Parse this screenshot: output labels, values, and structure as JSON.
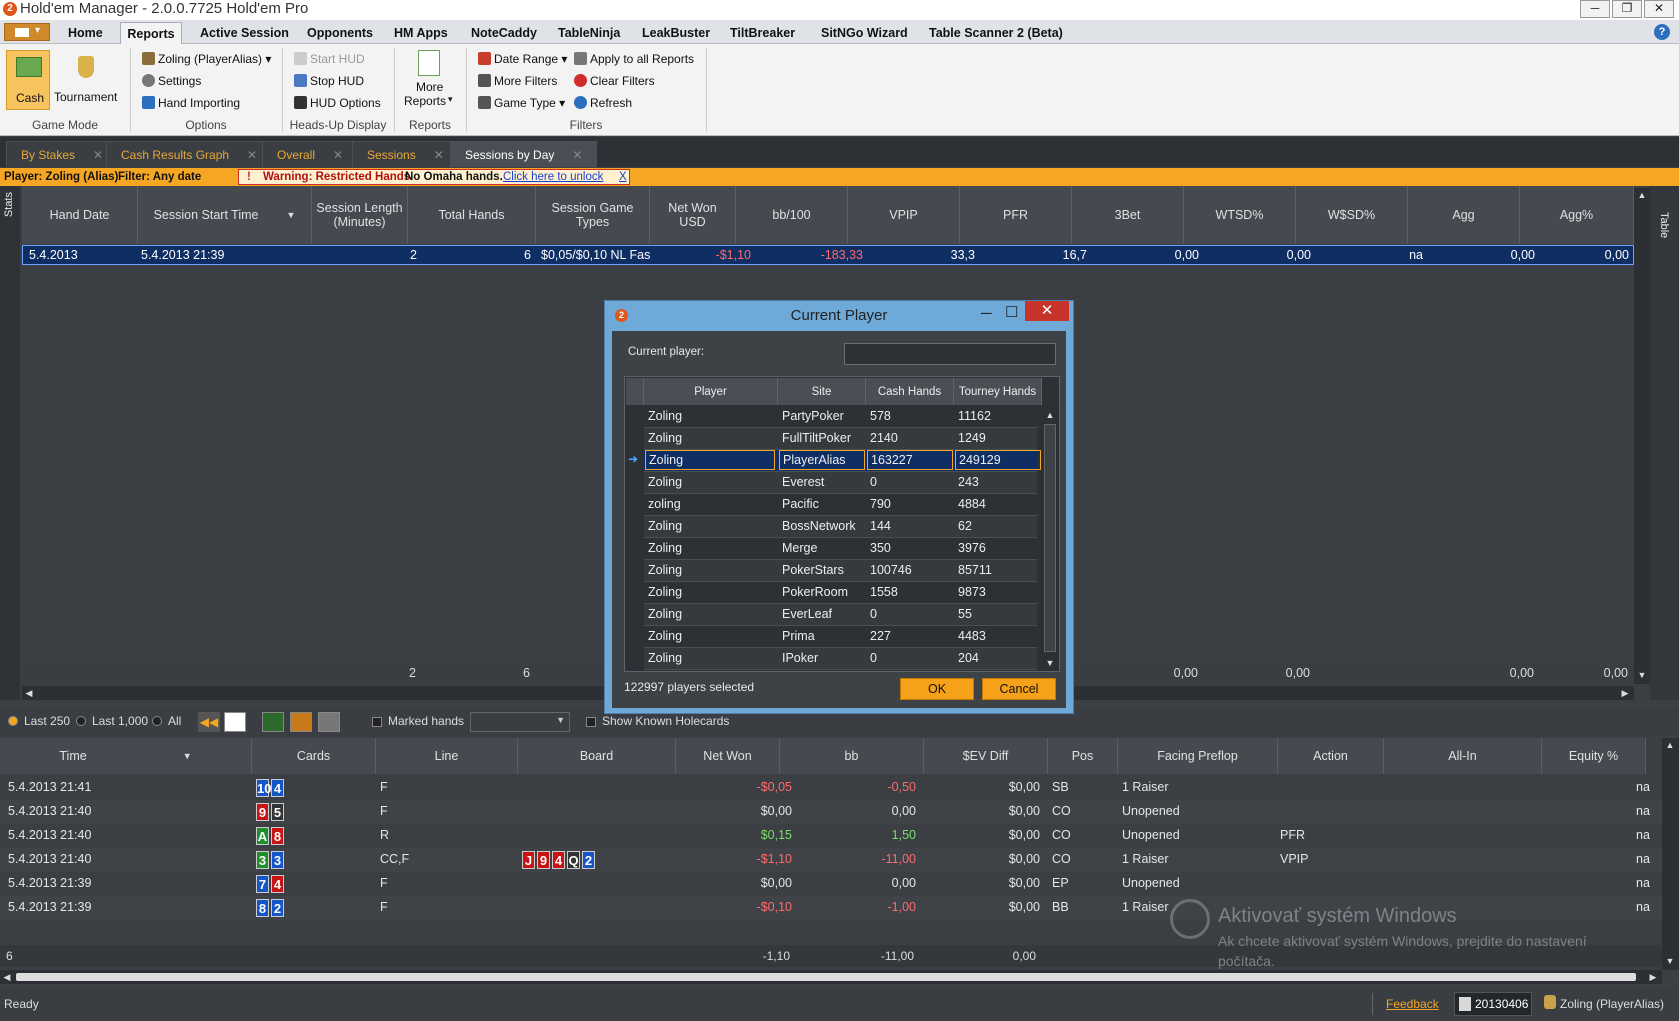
{
  "window": {
    "title": "Hold'em Manager - 2.0.0.7725 Hold'em Pro",
    "app_icon": "hm2-logo-icon",
    "controls": [
      "─",
      "❐",
      "✕"
    ]
  },
  "menu": {
    "app_button": "app-menu-icon",
    "tabs": [
      "Home",
      "Reports",
      "Active Session",
      "Opponents",
      "HM Apps",
      "NoteCaddy",
      "TableNinja",
      "LeakBuster",
      "TiltBreaker",
      "SitNGo Wizard",
      "Table Scanner 2 (Beta)"
    ],
    "active": "Reports",
    "help": "?"
  },
  "ribbon": {
    "game_mode": {
      "cash": "Cash",
      "tournament": "Tournament",
      "label": "Game Mode"
    },
    "options": {
      "player": "Zoling (PlayerAlias)",
      "settings": "Settings",
      "hand_importing": "Hand Importing",
      "label": "Options"
    },
    "hud": {
      "start": "Start HUD",
      "stop": "Stop HUD",
      "options": "HUD Options",
      "label": "Heads-Up Display"
    },
    "reports": {
      "more": "More",
      "reports": "Reports",
      "label": "Reports"
    },
    "filters": {
      "date_range": "Date Range",
      "more_filters": "More Filters",
      "game_type": "Game Type",
      "apply_all": "Apply to all Reports",
      "clear": "Clear Filters",
      "refresh": "Refresh",
      "label": "Filters"
    }
  },
  "doc_tabs": [
    {
      "label": "By Stakes"
    },
    {
      "label": "Cash Results Graph"
    },
    {
      "label": "Overall"
    },
    {
      "label": "Sessions"
    },
    {
      "label": "Sessions by Day"
    }
  ],
  "info": {
    "player": "Player: Zoling (Alias)",
    "filter": "Filter: Any date",
    "warning": "Warning: Restricted Hands",
    "no_omaha": "No Omaha hands.",
    "unlock": "Click here to unlock",
    "close": "X"
  },
  "side_tabs": {
    "stats": "Stats",
    "table": "Table"
  },
  "grid": {
    "headers": [
      "Hand Date",
      "Session Start Time",
      "Session Length (Minutes)",
      "Total Hands",
      "Session Game Types",
      "Net Won USD",
      "bb/100",
      "VPIP",
      "PFR",
      "3Bet",
      "WTSD%",
      "W$SD%",
      "Agg",
      "Agg%"
    ],
    "row": {
      "date": "5.4.2013",
      "start": "5.4.2013 21:39",
      "length": "2",
      "hands": "6",
      "types": "$0,05/$0,10 NL Fas",
      "net": "-$1,10",
      "bb100": "-183,33",
      "vpip": "33,3",
      "pfr": "16,7",
      "threebet": "0,00",
      "wtsd": "0,00",
      "wsd": "na",
      "agg": "0,00",
      "aggp": "0,00"
    },
    "footer": {
      "length": "2",
      "hands": "6",
      "threebet": "0,00",
      "wtsd": "0,00",
      "agg": "0,00",
      "aggp": "0,00"
    }
  },
  "hand_toolbar": {
    "last250": "Last 250",
    "last1000": "Last 1,000",
    "all": "All",
    "marked": "Marked hands",
    "known": "Show Known Holecards"
  },
  "hands": {
    "headers": [
      "Time",
      "Cards",
      "Line",
      "Board",
      "Net Won",
      "bb",
      "$EV Diff",
      "Pos",
      "Facing Preflop",
      "Action",
      "All-In",
      "Equity %"
    ],
    "rows": [
      {
        "time": "5.4.2013 21:41",
        "cards": [
          {
            "v": "10",
            "c": "b"
          },
          {
            "v": "4",
            "c": "b"
          }
        ],
        "line": "F",
        "board": [],
        "net": "-$0,05",
        "bb": "-0,50",
        "ev": "$0,00",
        "pos": "SB",
        "facing": "1 Raiser",
        "action": "",
        "eq": "na",
        "sign": "neg"
      },
      {
        "time": "5.4.2013 21:40",
        "cards": [
          {
            "v": "9",
            "c": "r"
          },
          {
            "v": "5",
            "c": "k"
          }
        ],
        "line": "F",
        "board": [],
        "net": "$0,00",
        "bb": "0,00",
        "ev": "$0,00",
        "pos": "CO",
        "facing": "Unopened",
        "action": "",
        "eq": "na",
        "sign": ""
      },
      {
        "time": "5.4.2013 21:40",
        "cards": [
          {
            "v": "A",
            "c": "g"
          },
          {
            "v": "8",
            "c": "r"
          }
        ],
        "line": "R",
        "board": [],
        "net": "$0,15",
        "bb": "1,50",
        "ev": "$0,00",
        "pos": "CO",
        "facing": "Unopened",
        "action": "PFR",
        "eq": "na",
        "sign": "pos"
      },
      {
        "time": "5.4.2013 21:40",
        "cards": [
          {
            "v": "3",
            "c": "g"
          },
          {
            "v": "3",
            "c": "b"
          }
        ],
        "line": "CC,F",
        "board": [
          {
            "v": "J",
            "c": "r"
          },
          {
            "v": "9",
            "c": "r"
          },
          {
            "v": "4",
            "c": "r"
          },
          {
            "v": "Q",
            "c": "k"
          },
          {
            "v": "2",
            "c": "b"
          }
        ],
        "net": "-$1,10",
        "bb": "-11,00",
        "ev": "$0,00",
        "pos": "CO",
        "facing": "1 Raiser",
        "action": "VPIP",
        "eq": "na",
        "sign": "neg"
      },
      {
        "time": "5.4.2013 21:39",
        "cards": [
          {
            "v": "7",
            "c": "b"
          },
          {
            "v": "4",
            "c": "r"
          }
        ],
        "line": "F",
        "board": [],
        "net": "$0,00",
        "bb": "0,00",
        "ev": "$0,00",
        "pos": "EP",
        "facing": "Unopened",
        "action": "",
        "eq": "na",
        "sign": ""
      },
      {
        "time": "5.4.2013 21:39",
        "cards": [
          {
            "v": "8",
            "c": "b"
          },
          {
            "v": "2",
            "c": "b"
          }
        ],
        "line": "F",
        "board": [],
        "net": "-$0,10",
        "bb": "-1,00",
        "ev": "$0,00",
        "pos": "BB",
        "facing": "1 Raiser",
        "action": "",
        "eq": "na",
        "sign": "neg"
      }
    ],
    "footer": {
      "count": "6",
      "net": "-1,10",
      "bb": "-11,00",
      "ev": "0,00"
    }
  },
  "status": {
    "ready": "Ready",
    "feedback": "Feedback",
    "db": "20130406",
    "player": "Zoling (PlayerAlias)"
  },
  "watermark": {
    "title": "Aktivovať systém Windows",
    "line1": "Ak chcete aktivovať systém Windows, prejdite do nastavení",
    "line2": "počítača."
  },
  "dialog": {
    "title": "Current Player",
    "icon": "hm2-logo-icon",
    "controls": [
      "─",
      "☐",
      "✕"
    ],
    "label": "Current player:",
    "input_value": "",
    "headers": [
      "Player",
      "Site",
      "Cash Hands",
      "Tourney Hands"
    ],
    "rows": [
      [
        "Zoling",
        "PartyPoker",
        "578",
        "11162"
      ],
      [
        "Zoling",
        "FullTiltPoker",
        "2140",
        "1249"
      ],
      [
        "Zoling",
        "PlayerAlias",
        "163227",
        "249129"
      ],
      [
        "Zoling",
        "Everest",
        "0",
        "243"
      ],
      [
        "zoling",
        "Pacific",
        "790",
        "4884"
      ],
      [
        "Zoling",
        "BossNetwork",
        "144",
        "62"
      ],
      [
        "Zoling",
        "Merge",
        "350",
        "3976"
      ],
      [
        "Zoling",
        "PokerStars",
        "100746",
        "85711"
      ],
      [
        "Zoling",
        "PokerRoom",
        "1558",
        "9873"
      ],
      [
        "Zoling",
        "EverLeaf",
        "0",
        "55"
      ],
      [
        "Zoling",
        "Prima",
        "227",
        "4483"
      ],
      [
        "Zoling",
        "IPoker",
        "0",
        "204"
      ]
    ],
    "selected_index": 2,
    "status": "122997 players selected",
    "ok": "OK",
    "cancel": "Cancel"
  },
  "colors": {
    "accent": "#f5a623",
    "selected_row": "#0f2e63",
    "negative": "#ff6a6a",
    "positive": "#7ddc6a"
  }
}
